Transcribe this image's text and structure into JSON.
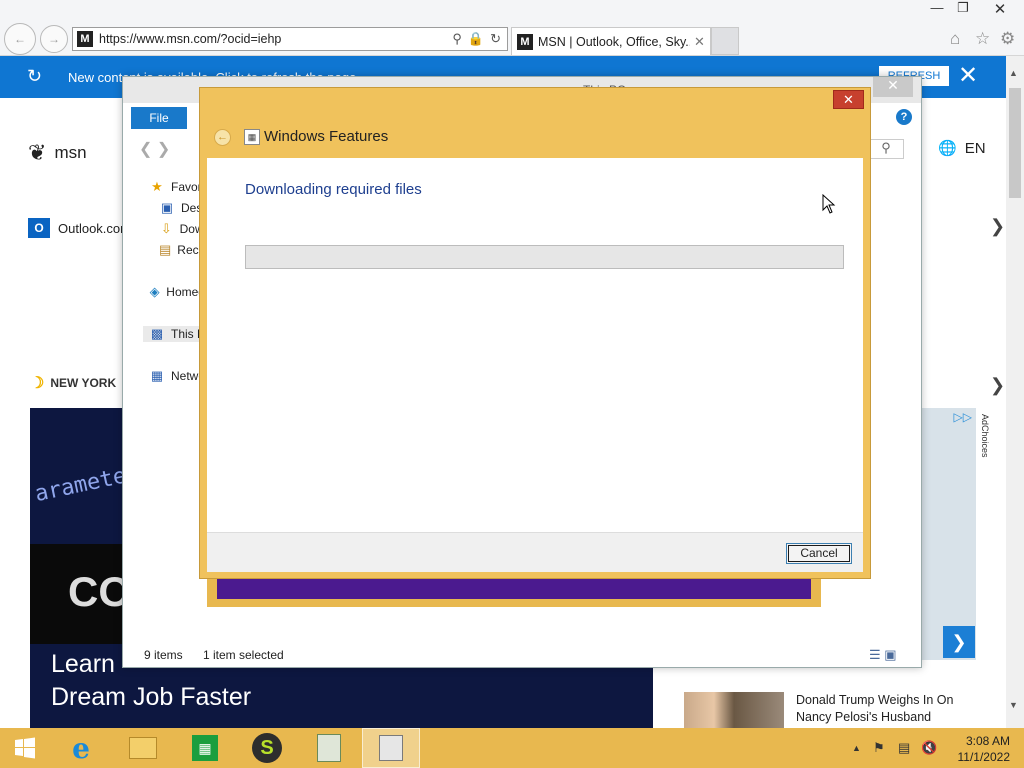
{
  "browser": {
    "url": "https://www.msn.com/?ocid=iehp",
    "tab_title": "MSN | Outlook, Office, Sky...",
    "favicon_letter": "M"
  },
  "notification": {
    "message": "New content is available. Click to refresh the page.",
    "refresh_label": "REFRESH"
  },
  "msn": {
    "logo_text": "msn",
    "language": "EN",
    "outlook_link": "Outlook.com",
    "weather_location": "NEW YORK",
    "hero_code_text": "arameters",
    "hero_block_text": "CO",
    "hero_headline_line1": "Learn",
    "hero_headline_line2": "Dream Job Faster",
    "adchoices": "AdChoices",
    "news_title": "Donald Trump Weighs In On Nancy Pelosi's Husband"
  },
  "explorer": {
    "title": "This PC",
    "file_tab": "File",
    "nav_items": [
      {
        "label": "Favorites",
        "icon": "star-icon"
      },
      {
        "label": "Desktop",
        "icon": "desktop-icon"
      },
      {
        "label": "Downloads",
        "icon": "downloads-icon"
      },
      {
        "label": "Recent places",
        "icon": "recent-icon"
      },
      {
        "label": "Homegroup",
        "icon": "homegroup-icon"
      },
      {
        "label": "This PC",
        "icon": "computer-icon"
      },
      {
        "label": "Network",
        "icon": "network-icon"
      }
    ],
    "status_items": "9 items",
    "status_selected": "1 item selected"
  },
  "dialog": {
    "title": "Windows Features",
    "heading": "Downloading required files",
    "progress_percent": 0,
    "cancel_label": "Cancel"
  },
  "taskbar": {
    "time": "3:08 AM",
    "date": "11/1/2022",
    "apps": [
      "internet-explorer",
      "file-explorer",
      "store",
      "green-app",
      "notepad-app",
      "windows-features-app"
    ]
  },
  "colors": {
    "accent_blue": "#0f76d2",
    "taskbar": "#e8b84f",
    "dialog_frame": "#f0c25c",
    "close_red": "#c7402e"
  }
}
